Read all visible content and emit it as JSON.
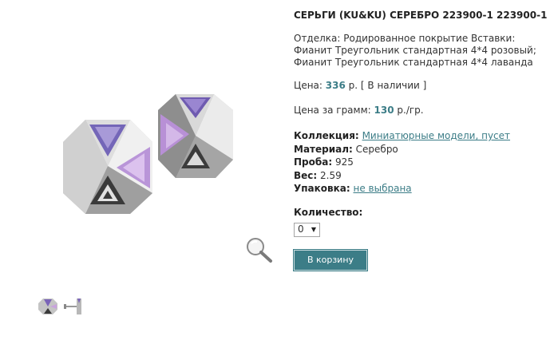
{
  "product": {
    "title": "СЕРЬГИ (KU&KU) СЕРЕБРО 223900-1 223900-1",
    "description": "Отделка: Родированное покрытие Вставки: Фианит Треугольник стандартная 4*4 розовый; Фианит Треугольник стандартная 4*4 лаванда",
    "price_label": "Цена:",
    "price_value": "336",
    "price_suffix": "р. [ В наличии ]",
    "gram_label": "Цена за грамм:",
    "gram_value": "130",
    "gram_suffix": "р./гр.",
    "collection_label": "Коллекция:",
    "collection_value": "Миниатюрные модели, пусет",
    "material_label": "Материал:",
    "material_value": "Серебро",
    "probe_label": "Проба:",
    "probe_value": "925",
    "weight_label": "Вес:",
    "weight_value": "2.59",
    "package_label": "Упаковка:",
    "package_value": "не выбрана",
    "qty_label": "Количество:",
    "qty_value": "0",
    "cart_button": "В корзину"
  },
  "icons": {
    "zoom": "magnifier-icon",
    "select_arrow": "triangle-down-icon"
  },
  "colors": {
    "accent": "#3c7d87",
    "lavender_stone": "#7a64b8",
    "pink_stone": "#c9a3dd",
    "silver": "#c9c9c9"
  }
}
